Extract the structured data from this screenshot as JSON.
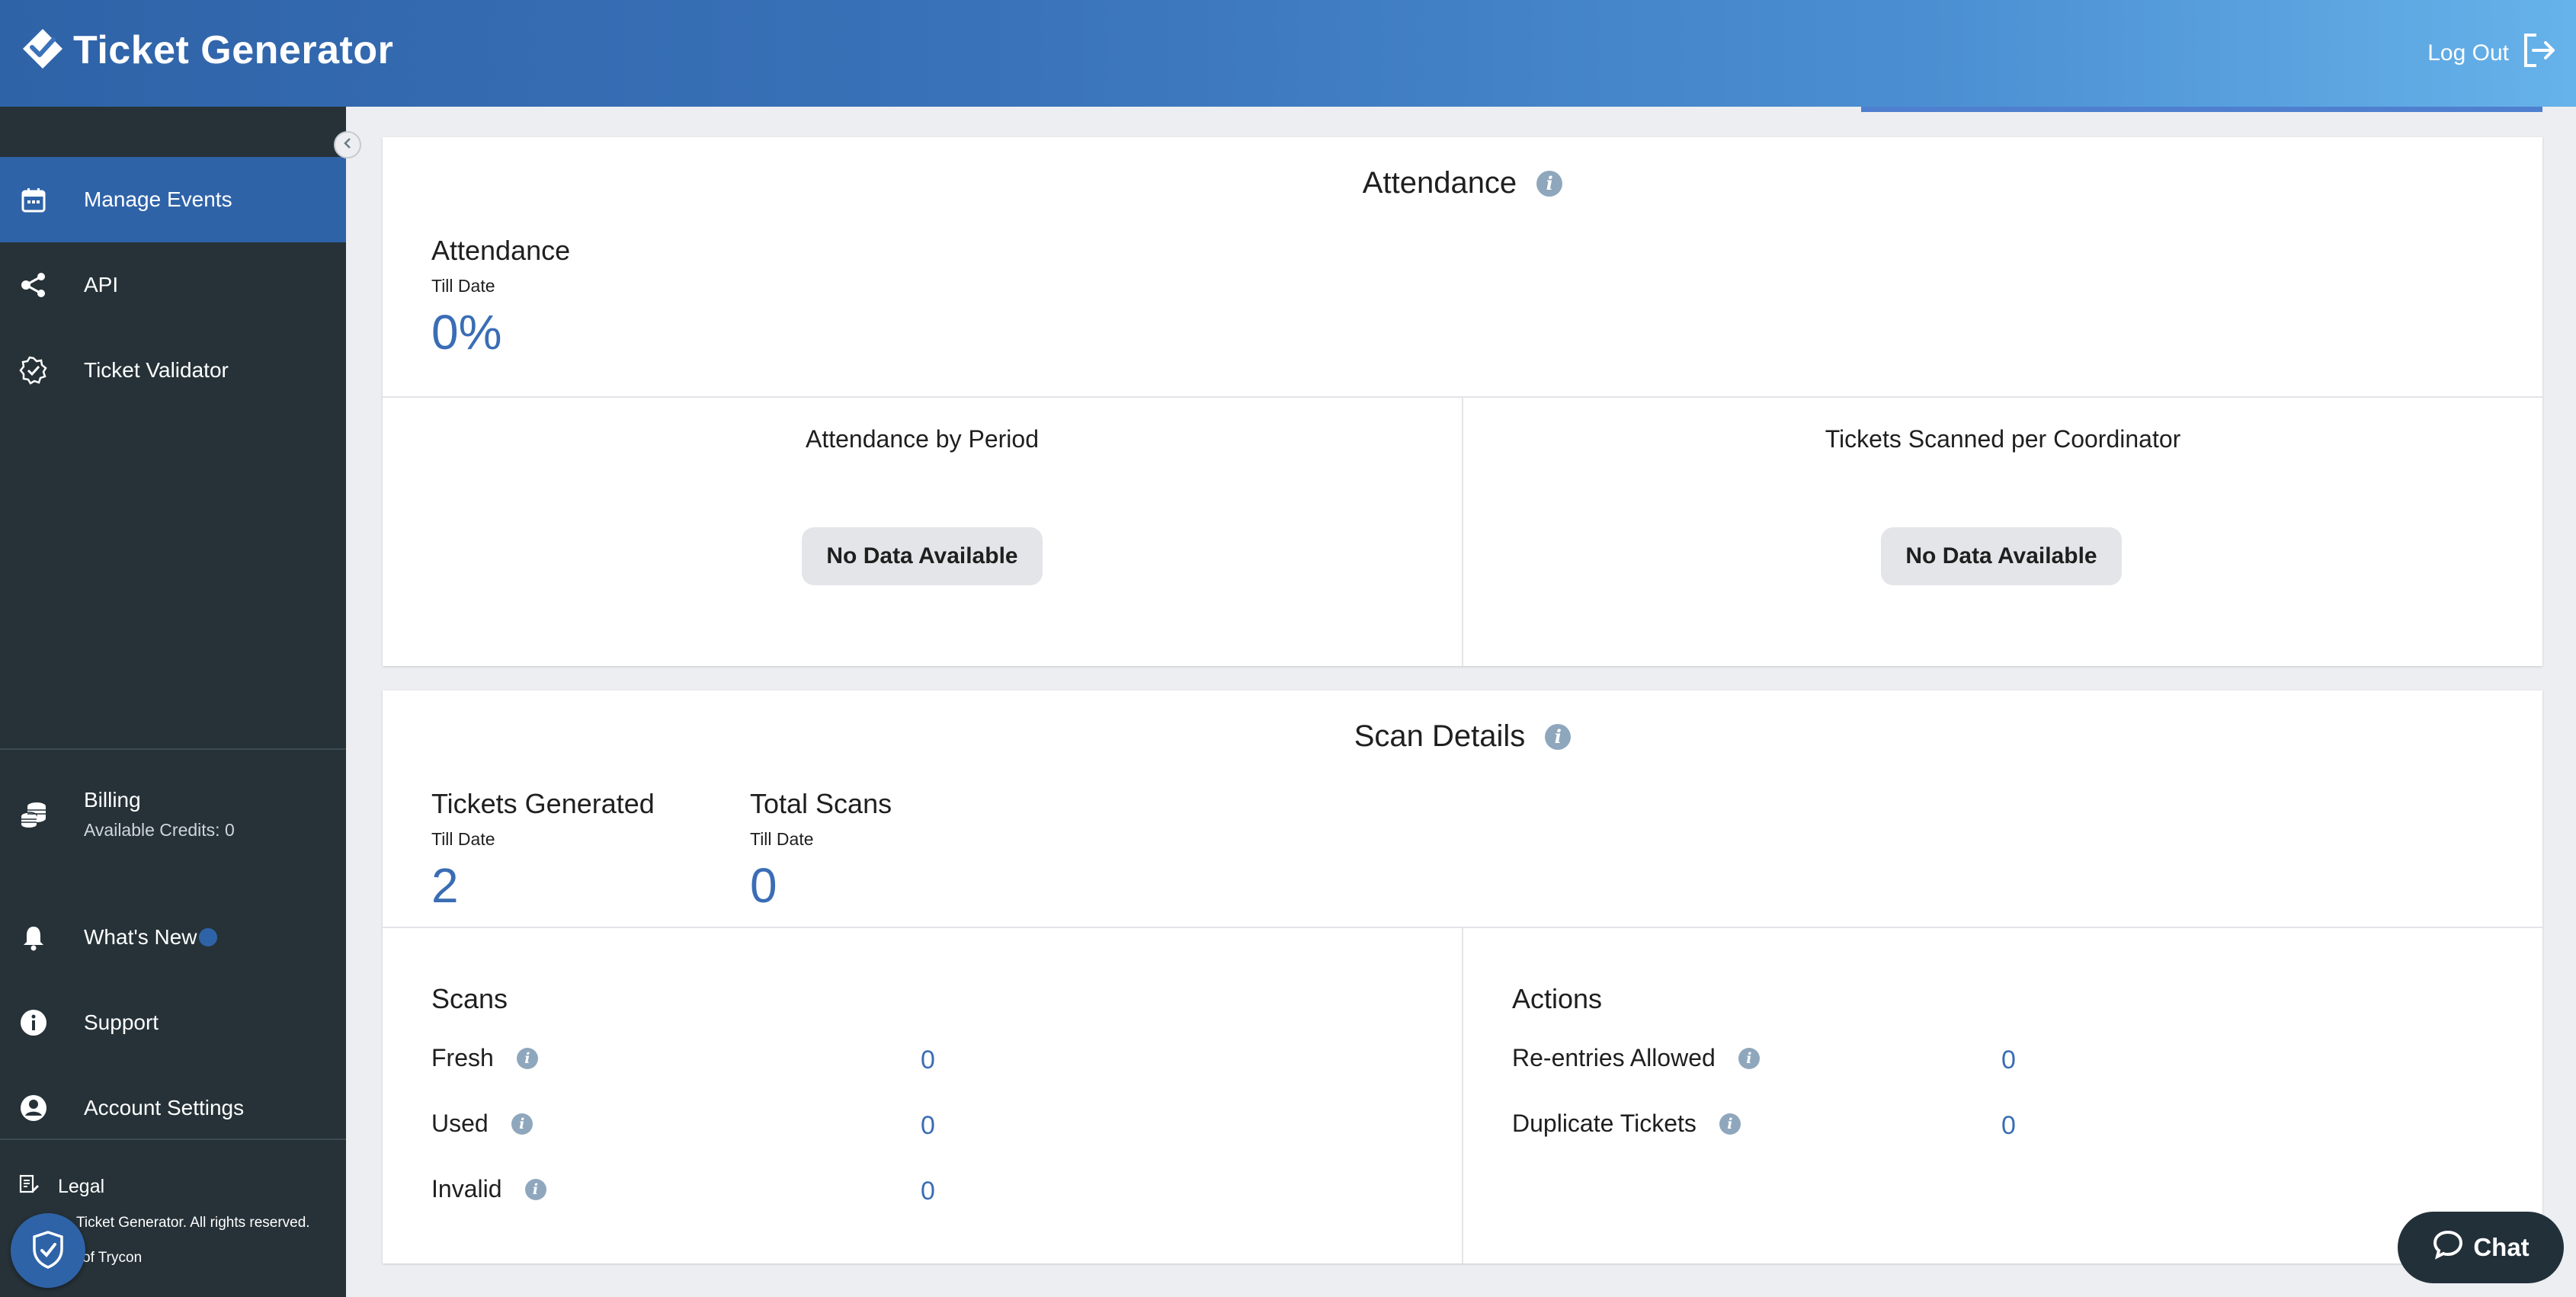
{
  "app": {
    "title": "Ticket Generator"
  },
  "header": {
    "logout_label": "Log Out"
  },
  "sidebar": {
    "items": [
      {
        "label": "Manage Events",
        "icon": "calendar-icon",
        "active": true
      },
      {
        "label": "API",
        "icon": "share-icon"
      },
      {
        "label": "Ticket Validator",
        "icon": "verified-badge-icon"
      }
    ],
    "billing": {
      "label": "Billing",
      "credits": "Available Credits: 0",
      "icon": "coins-icon"
    },
    "whats_new": {
      "label": "What's New",
      "icon": "bell-icon"
    },
    "support": {
      "label": "Support",
      "icon": "info-icon"
    },
    "account": {
      "label": "Account Settings",
      "icon": "account-circle-icon"
    },
    "legal": {
      "label": "Legal",
      "icon": "document-edit-icon"
    },
    "copyright_1": "Ticket Generator. All rights reserved.",
    "copyright_2": "of Trycon"
  },
  "attendance": {
    "title": "Attendance",
    "stat": {
      "label": "Attendance",
      "sub": "Till Date",
      "value": "0%"
    },
    "by_period": {
      "title": "Attendance by Period",
      "empty": "No Data Available"
    },
    "per_coordinator": {
      "title": "Tickets Scanned per Coordinator",
      "empty": "No Data Available"
    }
  },
  "scan_details": {
    "title": "Scan Details",
    "tickets_generated": {
      "label": "Tickets Generated",
      "sub": "Till Date",
      "value": "2"
    },
    "total_scans": {
      "label": "Total Scans",
      "sub": "Till Date",
      "value": "0"
    },
    "scans": {
      "title": "Scans",
      "rows": [
        {
          "label": "Fresh",
          "value": "0"
        },
        {
          "label": "Used",
          "value": "0"
        },
        {
          "label": "Invalid",
          "value": "0"
        }
      ]
    },
    "actions": {
      "title": "Actions",
      "rows": [
        {
          "label": "Re-entries Allowed",
          "value": "0"
        },
        {
          "label": "Duplicate Tickets",
          "value": "0"
        }
      ]
    }
  },
  "chat": {
    "label": "Chat"
  },
  "colors": {
    "primary": "#2f63a8",
    "sidebar": "#263238",
    "accent_value": "#3a6db5"
  }
}
